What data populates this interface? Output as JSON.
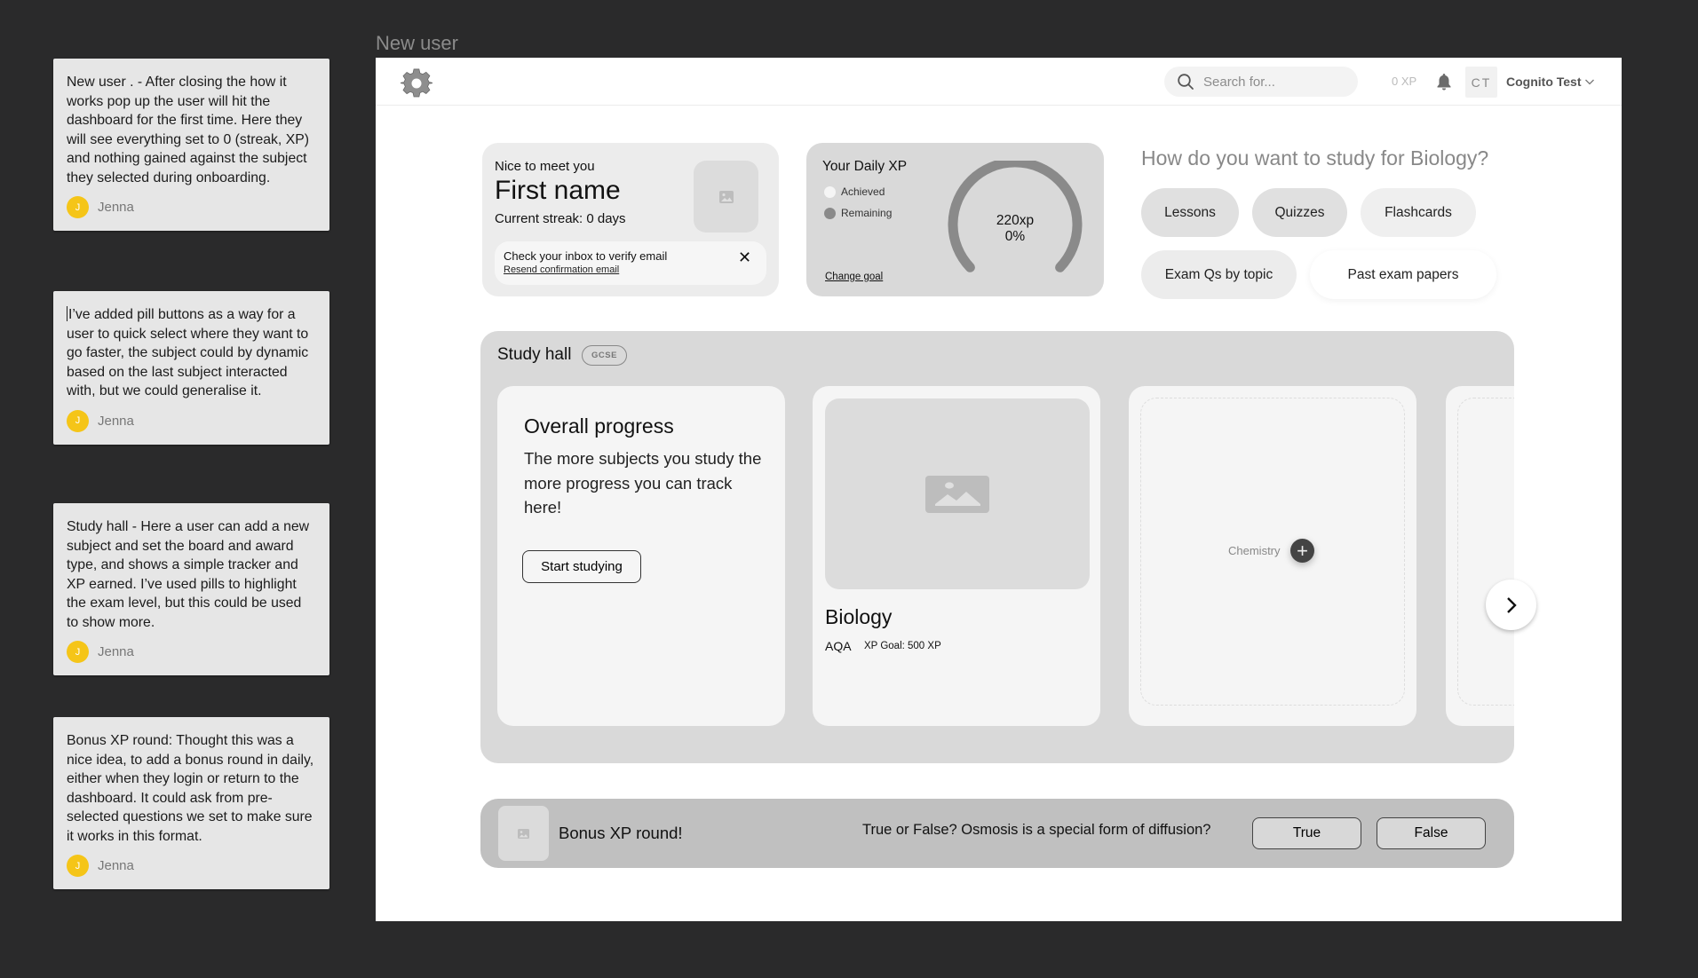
{
  "frame_label": "New user",
  "comments": [
    {
      "text": "New user . - After closing the how it works pop up the user will hit the dashboard for the first time. Here they will see everything set to 0 (streak, XP) and nothing gained against the subject they selected during onboarding.",
      "author": "Jenna",
      "initial": "J"
    },
    {
      "text": "I’ve added pill buttons as a way for a user to quick select where they want to go faster, the subject could by dynamic based on the last subject interacted with, but we could generalise it.",
      "author": "Jenna",
      "initial": "J"
    },
    {
      "text": "Study hall - Here a user can add a new subject and set the board and award type, and shows a simple tracker and XP earned. I’ve used pills to highlight the exam level, but this could be used to show more.",
      "author": "Jenna",
      "initial": "J"
    },
    {
      "text": "Bonus XP round: Thought this was a nice idea, to add a bonus round in daily, either when they login or return to the dashboard. It could ask from pre-selected questions we set to make sure it works in this format.",
      "author": "Jenna",
      "initial": "J"
    }
  ],
  "topbar": {
    "search_placeholder": "Search for...",
    "xp": "0 XP",
    "initials": "CT",
    "user_name": "Cognito Test"
  },
  "welcome": {
    "greeting": "Nice to meet you",
    "name": "First name",
    "streak": "Current streak: 0 days",
    "banner_text": "Check your inbox to verify email",
    "banner_link": "Resend confirmation email",
    "close": "✕"
  },
  "daily_xp": {
    "title": "Your Daily XP",
    "legend": [
      {
        "label": "Achieved",
        "color": "#f5f5f5"
      },
      {
        "label": "Remaining",
        "color": "#8a8a8a"
      }
    ],
    "value": "220xp",
    "percent": "0%",
    "progress": 0,
    "change_goal": "Change goal"
  },
  "study_options": {
    "title": "How do you want to study for Biology?",
    "pills": [
      "Lessons",
      "Quizzes",
      "Flashcards",
      "Exam Qs by topic",
      "Past exam papers"
    ]
  },
  "study_hall": {
    "title": "Study hall",
    "level_badge": "GCSE",
    "overall": {
      "title": "Overall progress",
      "body": "The more subjects you study the more progress you can track here!",
      "button": "Start studying"
    },
    "subject": {
      "name": "Biology",
      "board": "AQA",
      "goal": "XP Goal: 500 XP"
    },
    "add_subject": {
      "label": "Chemistry",
      "icon": "+"
    }
  },
  "bonus": {
    "title": "Bonus XP round!",
    "question": "True or False? Osmosis is a special form of diffusion?",
    "true_label": "True",
    "false_label": "False"
  }
}
